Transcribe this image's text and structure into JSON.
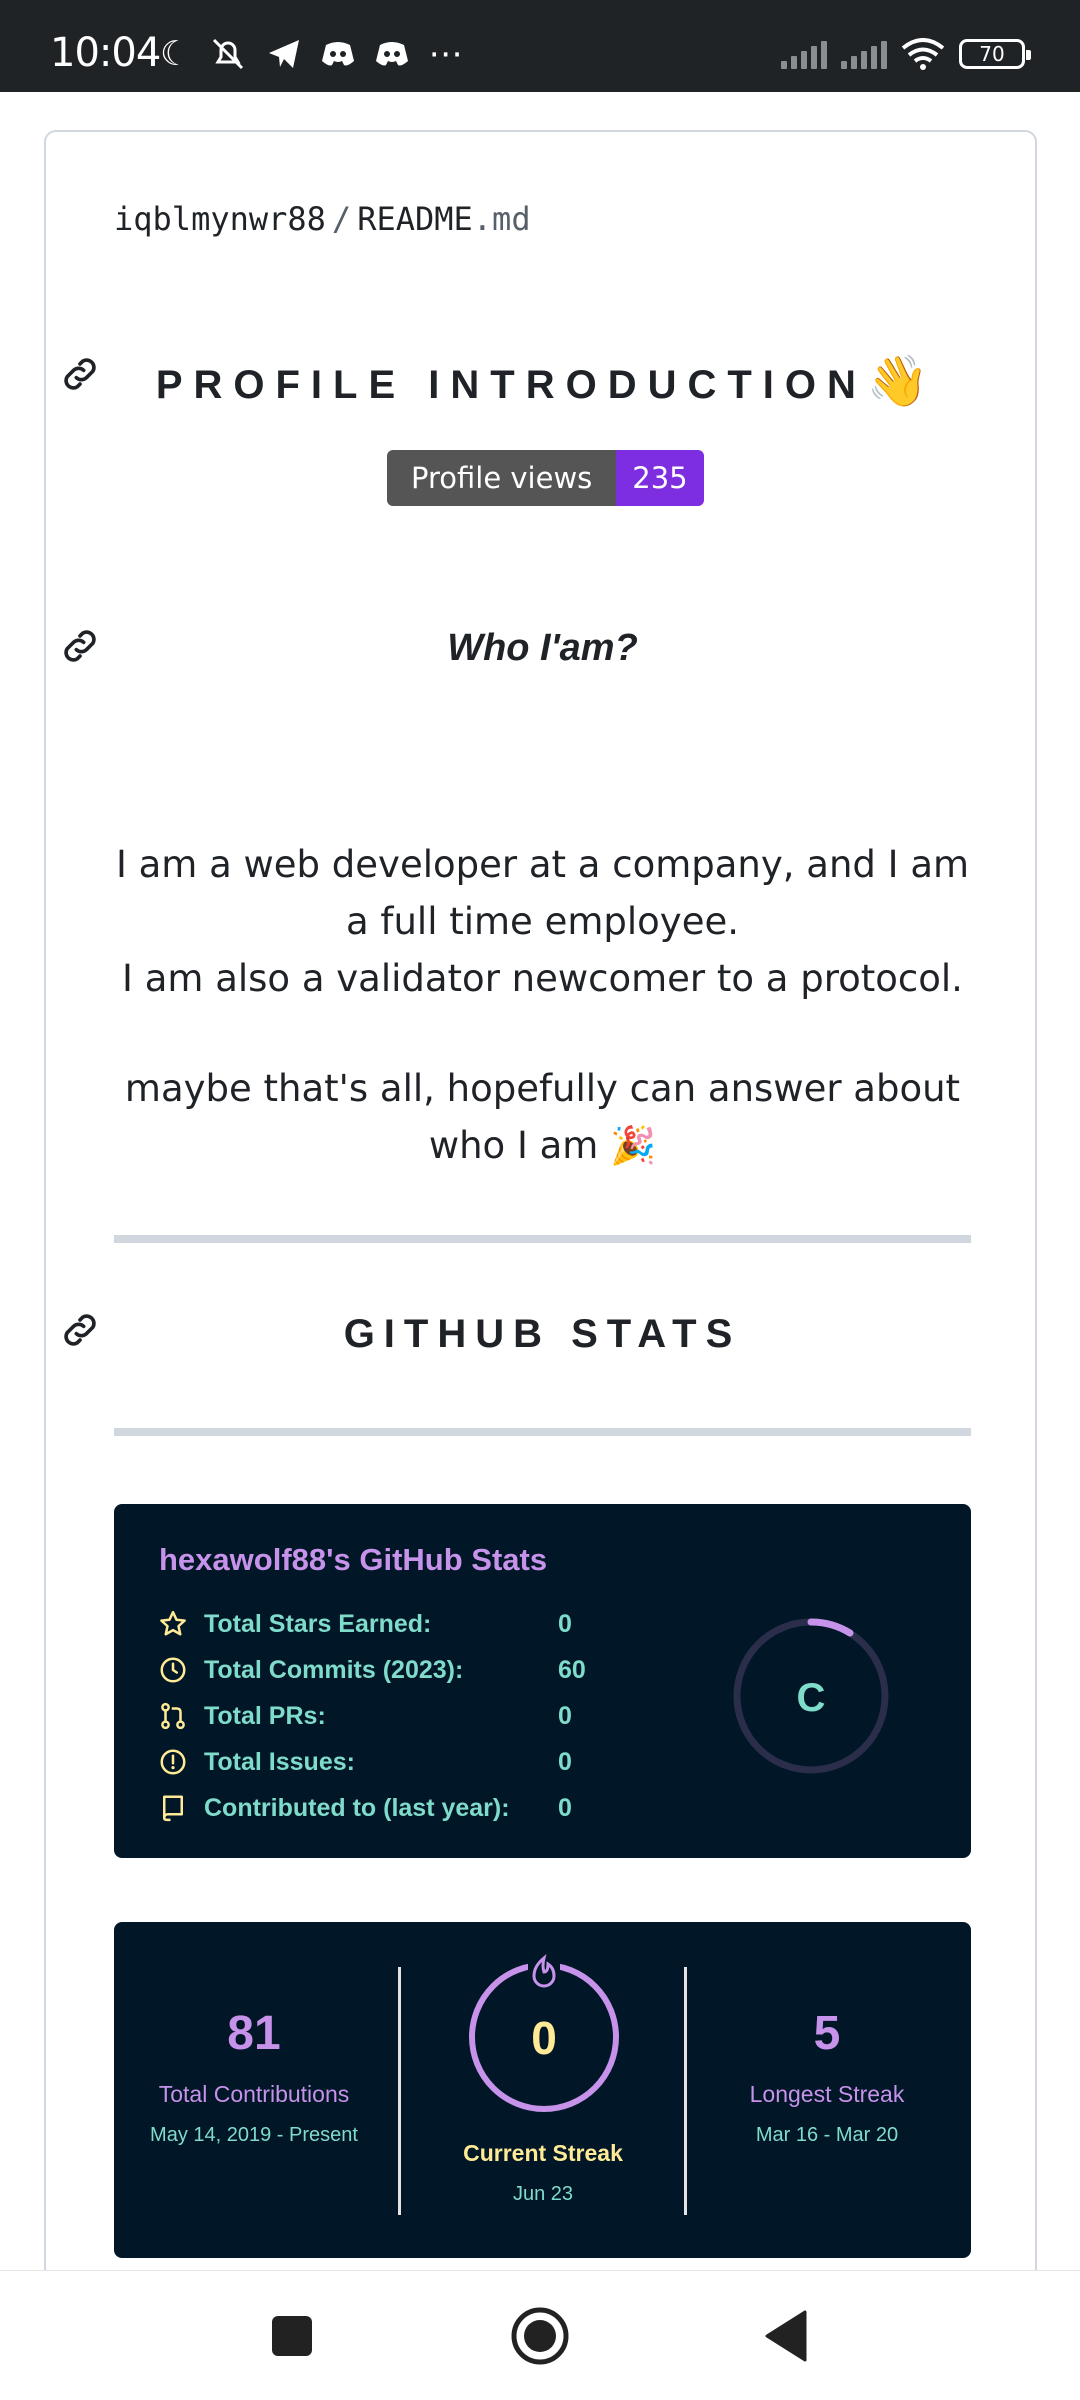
{
  "status_bar": {
    "time": "10:04",
    "battery": "70"
  },
  "file": {
    "owner": "iqblmynwr88",
    "separator": "/",
    "name": "README",
    "ext": ".md"
  },
  "intro": {
    "heading": "PROFILE INTRODUCTION",
    "emoji": "👋",
    "badge_label": "Profile views",
    "badge_value": "235"
  },
  "who": {
    "heading": "Who I'am?",
    "line1": "I am a web developer at a company, and I am a full time employee.",
    "line2": "I am also a validator newcomer to a protocol.",
    "line3": "maybe that's all, hopefully can answer about who I am",
    "emoji": "🎉"
  },
  "github": {
    "heading": "GITHUB STATS",
    "card_title": "hexawolf88's GitHub Stats",
    "rows": [
      {
        "label": "Total Stars Earned:",
        "value": "0",
        "icon": "star-icon"
      },
      {
        "label": "Total Commits (2023):",
        "value": "60",
        "icon": "clock-icon"
      },
      {
        "label": "Total PRs:",
        "value": "0",
        "icon": "pull-request-icon"
      },
      {
        "label": "Total Issues:",
        "value": "0",
        "icon": "issue-icon"
      },
      {
        "label": "Contributed to (last year):",
        "value": "0",
        "icon": "book-icon"
      }
    ],
    "rank": "C",
    "colors": {
      "background": "#011627",
      "title": "#c792ea",
      "text": "#7fdbca",
      "ring": "#c792ea"
    }
  },
  "streak": {
    "total": "81",
    "total_label": "Total Contributions",
    "total_range": "May 14, 2019 - Present",
    "current": "0",
    "current_label": "Current Streak",
    "current_date": "Jun 23",
    "longest": "5",
    "longest_label": "Longest Streak",
    "longest_range": "Mar 16 - Mar 20"
  },
  "nav": {
    "buttons": [
      "recents-button",
      "home-button",
      "back-button"
    ]
  }
}
